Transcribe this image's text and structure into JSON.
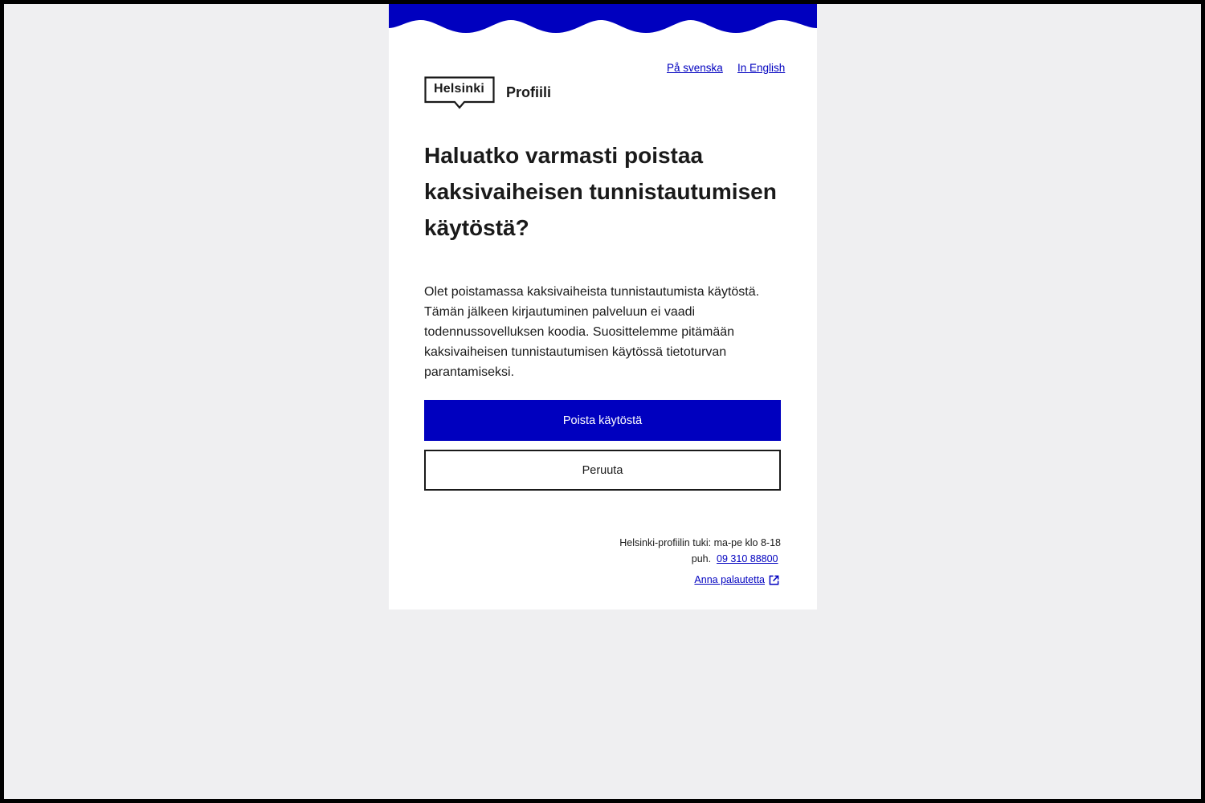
{
  "language_links": {
    "swedish": "På svenska",
    "english": "In English"
  },
  "brand": {
    "logo_text": "Helsinki",
    "app_name": "Profiili"
  },
  "dialog": {
    "heading": "Haluatko varmasti poistaa kaksivaiheisen tunnistautumisen käytöstä?",
    "body": "Olet poistamassa kaksivaiheista tunnistautumista käytöstä. Tämän jälkeen kirjautuminen palveluun ei vaadi todennussovelluksen koodia. Suosittelemme pitämään kaksivaiheisen tunnistautumisen käytössä tietoturvan parantamiseksi.",
    "confirm_label": "Poista käytöstä",
    "cancel_label": "Peruuta"
  },
  "footer": {
    "support_hours": "Helsinki-profiilin tuki: ma-pe klo 8-18",
    "phone_prefix": "puh.",
    "phone": "09 310 88800",
    "feedback_label": "Anna palautetta"
  },
  "colors": {
    "brand_blue": "#0000bf",
    "page_background": "#efeff1",
    "text": "#1a1a1a"
  },
  "icons": {
    "external_link": "external-link-icon"
  }
}
